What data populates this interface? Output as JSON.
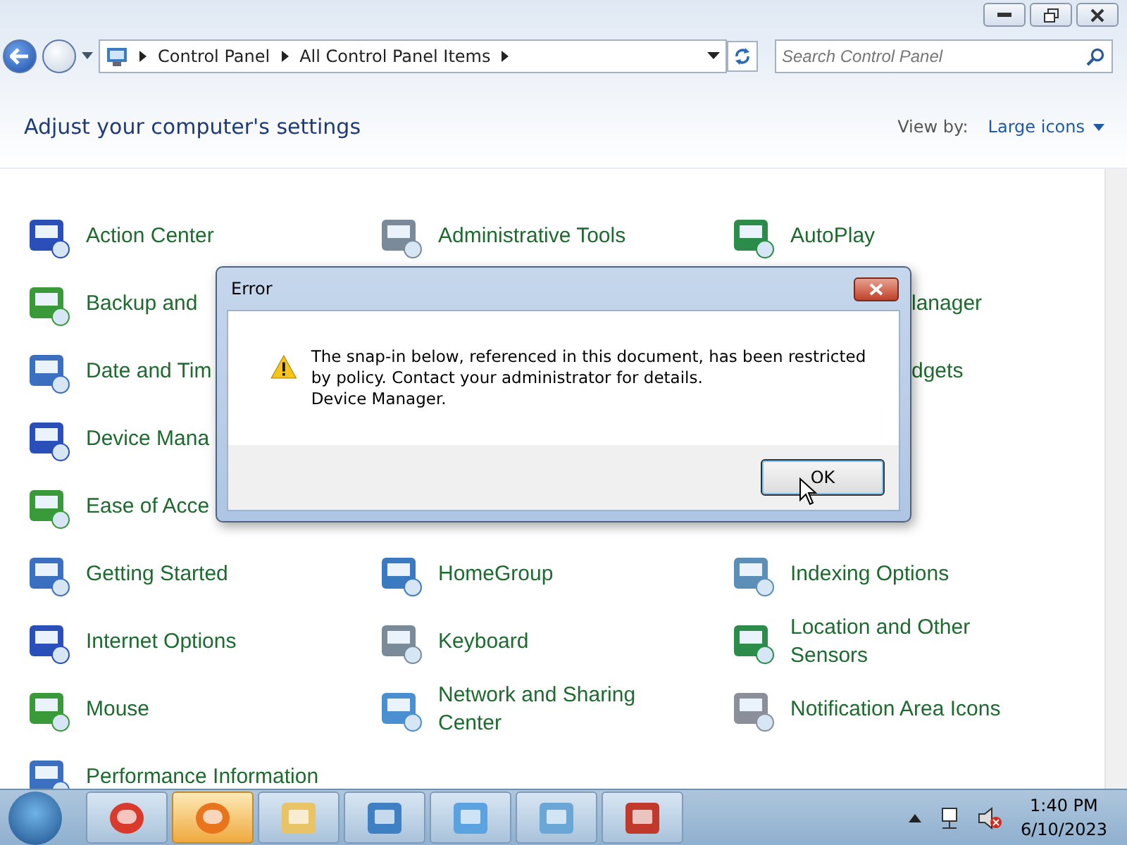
{
  "breadcrumb": [
    "Control Panel",
    "All Control Panel Items"
  ],
  "search": {
    "placeholder": "Search Control Panel"
  },
  "heading": "Adjust your computer's settings",
  "view_by": {
    "label": "View by:",
    "value": "Large icons"
  },
  "items": [
    {
      "kind": "full",
      "label": "Action Center"
    },
    {
      "kind": "full",
      "label": "Administrative Tools"
    },
    {
      "kind": "full",
      "label": "AutoPlay"
    },
    {
      "kind": "full",
      "label": "Backup and"
    },
    {
      "kind": "hidden"
    },
    {
      "kind": "clipped",
      "label": "lanager"
    },
    {
      "kind": "full",
      "label": "Date and Tim"
    },
    {
      "kind": "hidden"
    },
    {
      "kind": "clipped",
      "label": "dgets"
    },
    {
      "kind": "full",
      "label": "Device Mana"
    },
    {
      "kind": "hidden"
    },
    {
      "kind": "hidden"
    },
    {
      "kind": "full",
      "label": "Ease of Acce"
    },
    {
      "kind": "hidden"
    },
    {
      "kind": "hidden"
    },
    {
      "kind": "full",
      "label": "Getting Started"
    },
    {
      "kind": "full",
      "label": "HomeGroup"
    },
    {
      "kind": "full",
      "label": "Indexing Options"
    },
    {
      "kind": "full",
      "label": "Internet Options"
    },
    {
      "kind": "full",
      "label": "Keyboard"
    },
    {
      "kind": "full",
      "label": "Location and Other Sensors"
    },
    {
      "kind": "full",
      "label": "Mouse"
    },
    {
      "kind": "full",
      "label": "Network and Sharing Center"
    },
    {
      "kind": "full",
      "label": "Notification Area Icons"
    },
    {
      "kind": "full",
      "label": "Performance Information"
    }
  ],
  "dialog": {
    "title": "Error",
    "message": "The snap-in below, referenced in this document, has been restricted by policy. Contact your administrator for details.",
    "detail": "Device Manager.",
    "button": "OK"
  },
  "taskbar": {
    "buttons": [
      {
        "active": false
      },
      {
        "active": true
      },
      {
        "active": false
      },
      {
        "active": false
      },
      {
        "active": false
      },
      {
        "active": false
      },
      {
        "active": false
      }
    ],
    "time": "1:40 PM",
    "date": "6/10/2023"
  }
}
